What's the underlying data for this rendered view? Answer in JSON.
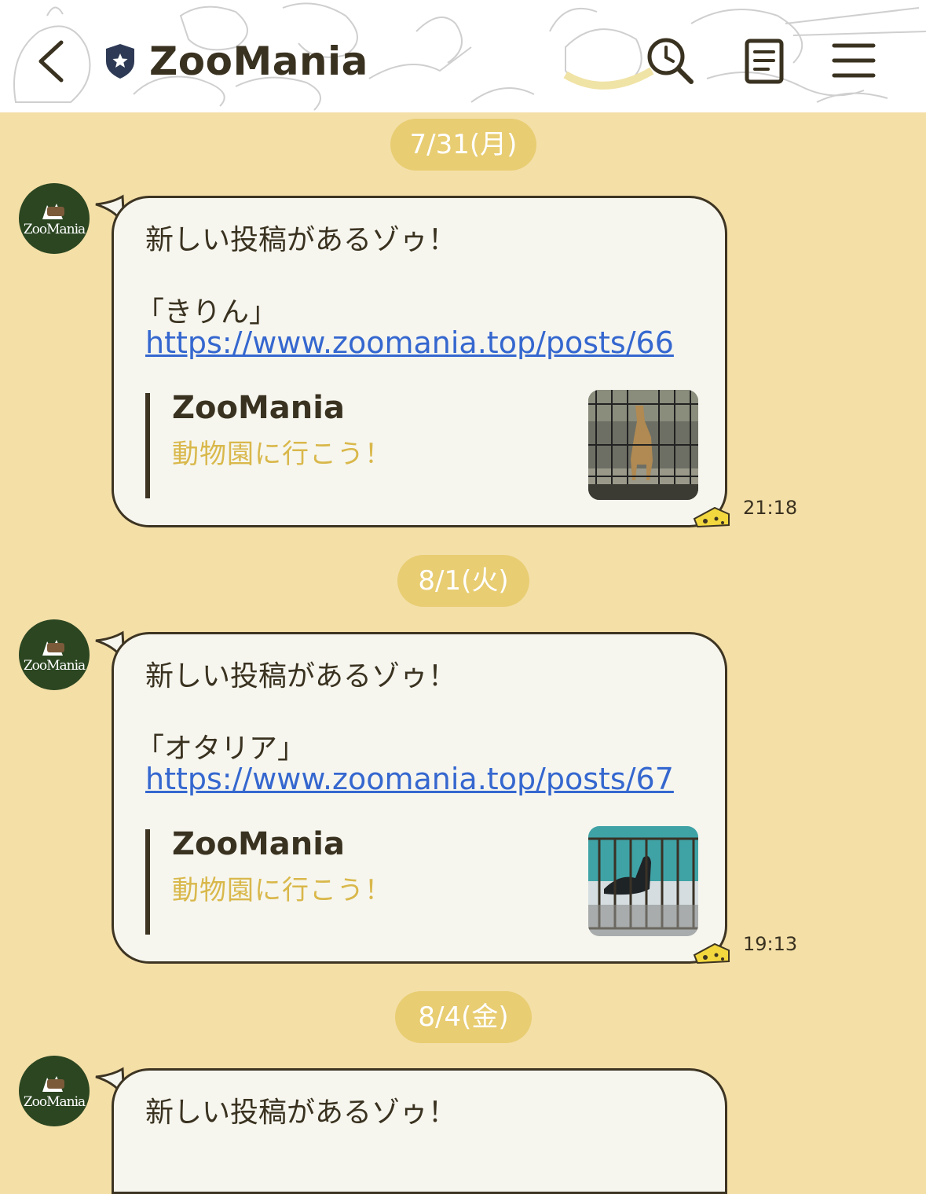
{
  "header": {
    "title": "ZooMania",
    "icons": [
      "chevron-left-icon",
      "shield-star-icon",
      "search-history-icon",
      "notes-icon",
      "menu-icon"
    ]
  },
  "messages": [
    {
      "date": "7/31(月)",
      "avatar_label": "ZooMania",
      "line1": "新しい投稿があるゾゥ！",
      "line2": "「きりん」",
      "link": "https://www.zoomania.top/posts/66",
      "preview_site": "ZooMania",
      "preview_desc": "動物園に行こう！",
      "thumbnail": "giraffe-photo",
      "time": "21:18"
    },
    {
      "date": "8/1(火)",
      "avatar_label": "ZooMania",
      "line1": "新しい投稿があるゾゥ！",
      "line2": "「オタリア」",
      "link": "https://www.zoomania.top/posts/67",
      "preview_site": "ZooMania",
      "preview_desc": "動物園に行こう！",
      "thumbnail": "sea-lion-photo",
      "time": "19:13"
    },
    {
      "date": "8/4(金)",
      "avatar_label": "ZooMania",
      "line1": "新しい投稿があるゾゥ！"
    }
  ],
  "colors": {
    "background": "#f4dfa7",
    "date_chip": "#e8cd72",
    "bubble": "#f6f6ef",
    "bubble_border": "#3d3422",
    "link": "#3567cf",
    "preview_desc": "#d9b84b",
    "avatar_bg": "#2b4621"
  }
}
